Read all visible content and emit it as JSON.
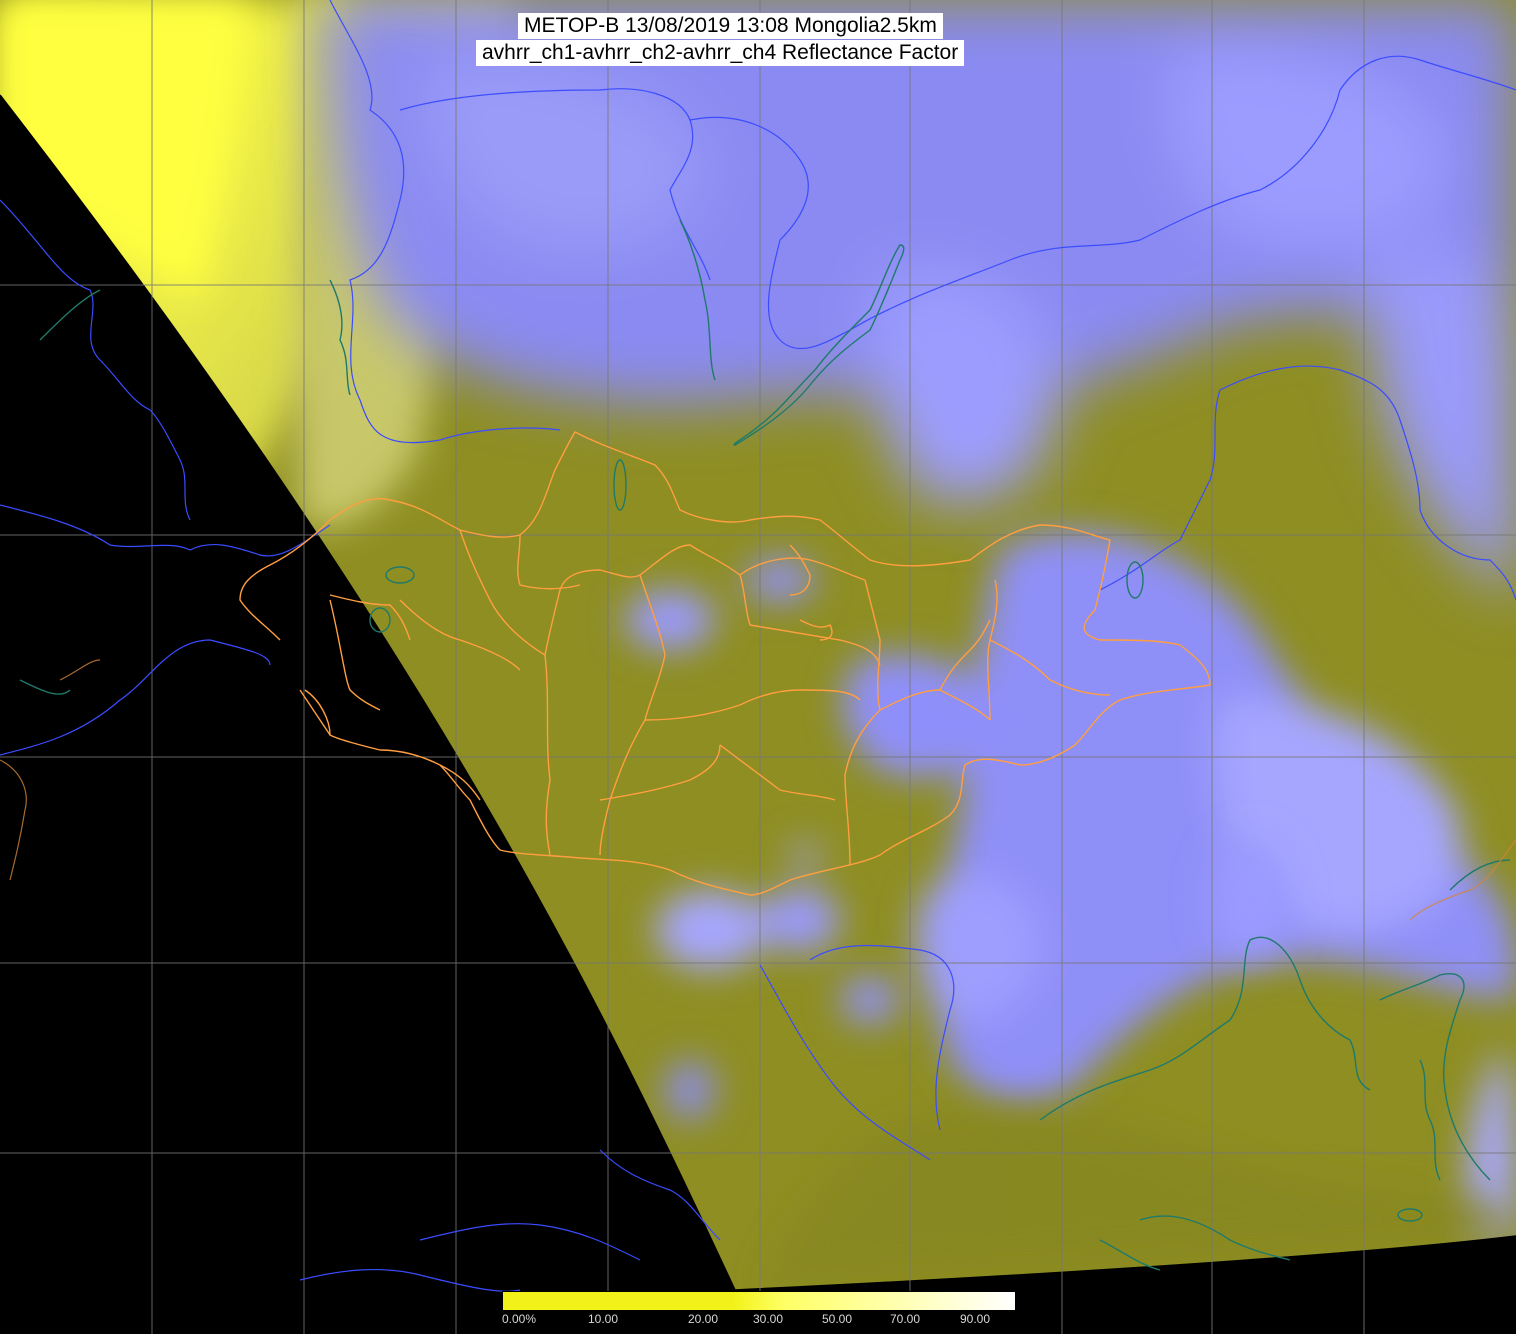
{
  "title": {
    "line1": "METOP-B 13/08/2019 13:08 Mongolia2.5km",
    "line2": "avhrr_ch1-avhrr_ch2-avhrr_ch4 Reflectance Factor"
  },
  "colorbar": {
    "labels": [
      "0.00%",
      "10.00",
      "20.00",
      "30.00",
      "50.00",
      "70.00",
      "90.00"
    ],
    "colors": {
      "low": "#f2f21a",
      "mid": "#ffff66",
      "high": "#ffffff"
    }
  },
  "map_colors": {
    "no_data": "#000000",
    "ground": "#8c8c1a",
    "haze": "#bdbd3a",
    "cloud": "#8a8aff",
    "cloud_bright": "#b0b0ff",
    "desert_bright": "#f5f542",
    "graticule": "#7a7a7a",
    "admin_border": "#ff9d3a",
    "country_border": "#3f4fff",
    "coastline": "#1f7a6a"
  }
}
